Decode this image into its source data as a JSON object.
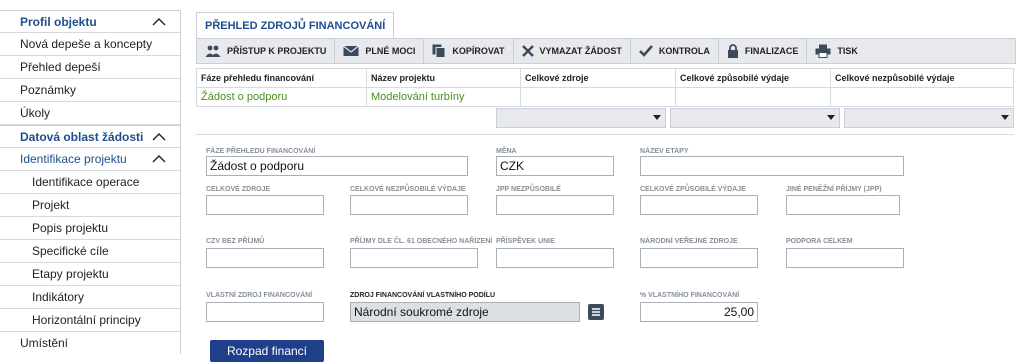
{
  "sidebar": {
    "items": [
      {
        "label": "Profil objektu"
      },
      {
        "label": "Nová depeše a koncepty"
      },
      {
        "label": "Přehled depeší"
      },
      {
        "label": "Poznámky"
      },
      {
        "label": "Úkoly"
      },
      {
        "label": "Datová oblast žádosti"
      },
      {
        "label": "Identifikace projektu"
      },
      {
        "label": "Identifikace operace"
      },
      {
        "label": "Projekt"
      },
      {
        "label": "Popis projektu"
      },
      {
        "label": "Specifické cíle"
      },
      {
        "label": "Etapy projektu"
      },
      {
        "label": "Indikátory"
      },
      {
        "label": "Horizontální principy"
      },
      {
        "label": "Umístění"
      }
    ]
  },
  "tab": {
    "label": "PŘEHLED ZDROJŮ FINANCOVÁNÍ"
  },
  "toolbar": {
    "pristup": "PŘÍSTUP K PROJEKTU",
    "plne_moci": "PLNÉ MOCI",
    "kopirovat": "KOPÍROVAT",
    "vymazat": "VYMAZAT ŽÁDOST",
    "kontrola": "KONTROLA",
    "finalizace": "FINALIZACE",
    "tisk": "TISK"
  },
  "grid": {
    "columns": [
      "Fáze přehledu financování",
      "Název projektu",
      "Celkové zdroje",
      "Celkové způsobilé výdaje",
      "Celkové nezpůsobilé výdaje"
    ],
    "row": [
      "Žádost o podporu",
      "Modelování turbíny",
      "",
      "",
      ""
    ]
  },
  "form": {
    "faze_label": "FÁZE PŘEHLEDU FINANCOVÁNÍ",
    "faze_value": "Žádost o podporu",
    "mena_label": "MĚNA",
    "mena_value": "CZK",
    "nazev_etapy_label": "NÁZEV ETAPY",
    "celkove_zdroje_label": "CELKOVÉ ZDROJE",
    "celkove_nezpusobile_label": "CELKOVÉ NEZPŮSOBILÉ VÝDAJE",
    "jpp_nezpusobile_label": "JPP NEZPŮSOBILÉ",
    "celkove_zpusobile_label": "CELKOVÉ ZPŮSOBILÉ VÝDAJE",
    "jine_penezni_label": "JINÉ PENĚŽNÍ PŘÍJMY (JPP)",
    "czv_bez_prijmu_label": "CZV BEZ PŘÍJMŮ",
    "prijmy_cl61_label": "PŘÍJMY DLE ČL. 61 OBECNÉHO NAŘÍZENÍ",
    "prispevek_unie_label": "PŘÍSPĚVEK UNIE",
    "narodni_verejne_label": "NÁRODNÍ VEŘEJNÉ ZDROJE",
    "podpora_celkem_label": "PODPORA CELKEM",
    "vlastni_zdroj_label": "VLASTNÍ ZDROJ FINANCOVÁNÍ",
    "zdroj_vlastniho_podilu_label": "ZDROJ FINANCOVÁNÍ VLASTNÍHO PODÍLU",
    "zdroj_vlastniho_podilu_value": "Národní soukromé zdroje",
    "procento_label": "% VLASTNÍHO FINANCOVÁNÍ",
    "procento_value": "25,00"
  },
  "actions": {
    "rozpad": "Rozpad financí"
  },
  "colors": {
    "accent": "#1f4e8c",
    "link_green": "#4a8f1c",
    "button": "#1f3f8a"
  }
}
